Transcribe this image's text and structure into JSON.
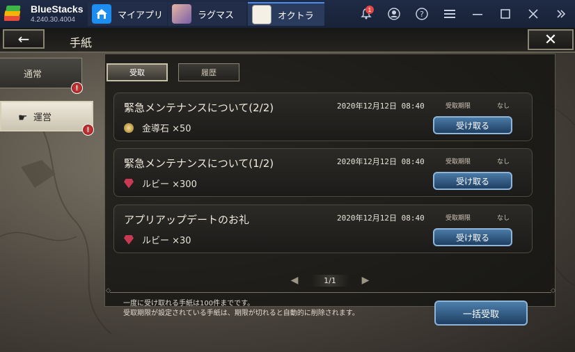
{
  "emulator": {
    "name": "BlueStacks",
    "version": "4.240.30.4004",
    "tabs": [
      {
        "label": "マイアプリ",
        "icon": "home-icon"
      },
      {
        "label": "ラグマス",
        "icon": "app-icon"
      },
      {
        "label": "オクトラ",
        "icon": "app-icon",
        "active": true
      }
    ],
    "notification_count": "1"
  },
  "screen": {
    "title": "手紙",
    "back_glyph": "←",
    "close_glyph": "✕"
  },
  "categories": [
    {
      "label": "通常",
      "alert": "!"
    },
    {
      "label": "運営",
      "alert": "!",
      "active": true
    }
  ],
  "subtabs": [
    {
      "label": "受取",
      "active": true
    },
    {
      "label": "履歴"
    }
  ],
  "mails": [
    {
      "title": "緊急メンテナンスについて(2/2)",
      "date": "2020年12月12日 08:40",
      "deadline_label": "受取期限",
      "deadline_value": "なし",
      "reward_icon": "gold-ore-icon",
      "reward": "金導石 ×50",
      "button": "受け取る"
    },
    {
      "title": "緊急メンテナンスについて(1/2)",
      "date": "2020年12月12日 08:40",
      "deadline_label": "受取期限",
      "deadline_value": "なし",
      "reward_icon": "ruby-icon",
      "reward": "ルビー ×300",
      "button": "受け取る"
    },
    {
      "title": "アプリアップデートのお礼",
      "date": "2020年12月12日 08:40",
      "deadline_label": "受取期限",
      "deadline_value": "なし",
      "reward_icon": "ruby-icon",
      "reward": "ルビー ×30",
      "button": "受け取る"
    }
  ],
  "pager": {
    "text": "1/1"
  },
  "notes": {
    "line1": "一度に受け取れる手紙は100件までです。",
    "line2": "受取期限が設定されている手紙は、期限が切れると自動的に削除されます。"
  },
  "bulk_button": "一括受取"
}
